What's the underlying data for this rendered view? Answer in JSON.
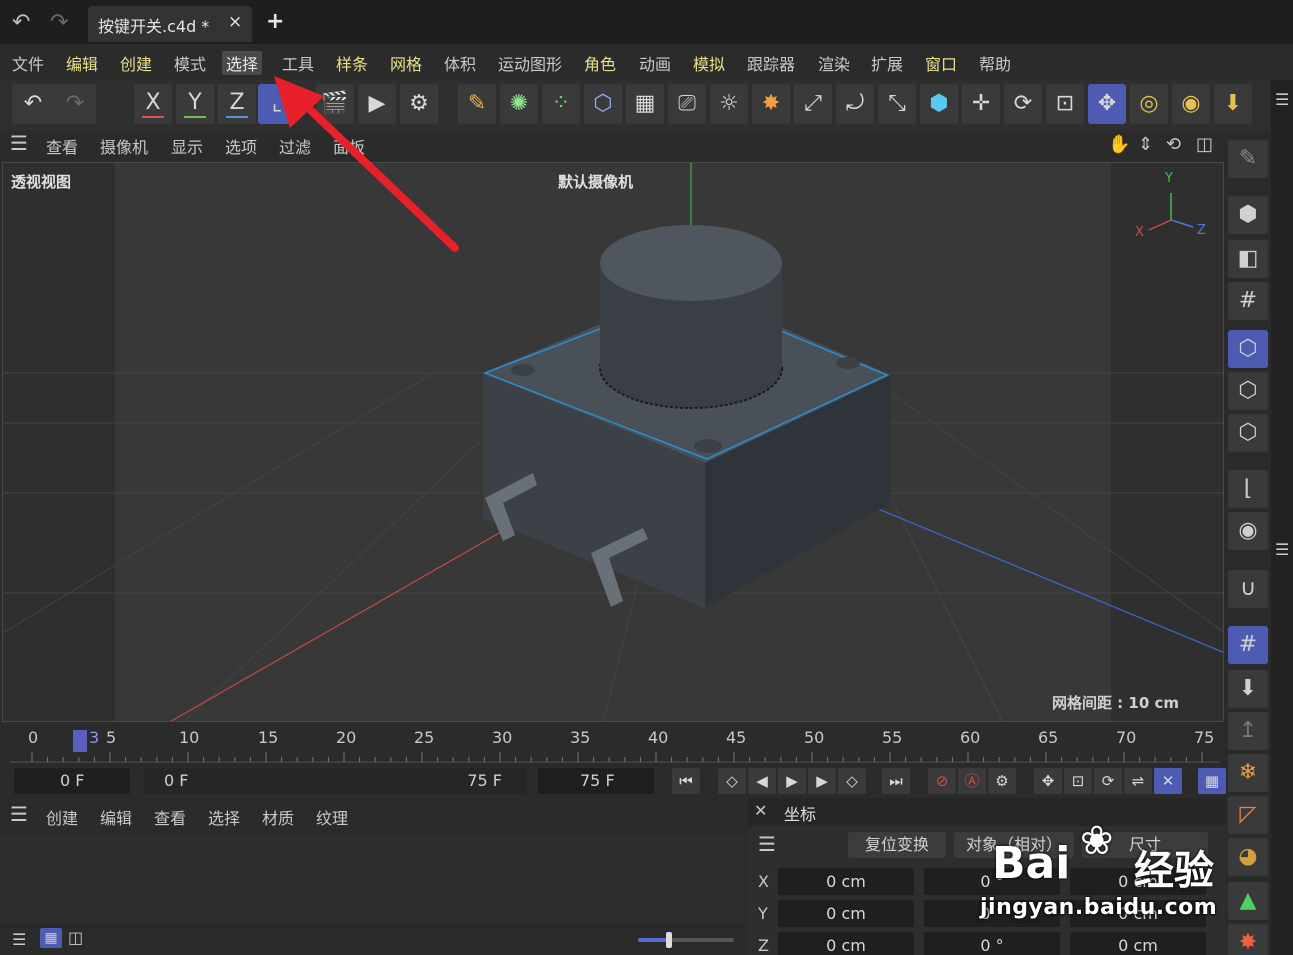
{
  "tabbar": {
    "tab_title": "按键开关.c4d *",
    "close_glyph": "×",
    "add_glyph": "+"
  },
  "menubar": {
    "items": [
      "文件",
      "编辑",
      "创建",
      "模式",
      "选择",
      "工具",
      "样条",
      "网格",
      "体积",
      "运动图形",
      "角色",
      "动画",
      "模拟",
      "跟踪器",
      "渲染",
      "扩展",
      "窗口",
      "帮助"
    ],
    "active": "选择"
  },
  "toolbar": {
    "axes": [
      "X",
      "Y",
      "Z"
    ],
    "axis_colors": [
      "#e05050",
      "#70c050",
      "#5a8ee8"
    ]
  },
  "viewport_menu": {
    "items": [
      "查看",
      "摄像机",
      "显示",
      "选项",
      "过滤",
      "面板"
    ]
  },
  "viewport": {
    "label": "透视视图",
    "camera": "默认摄像机",
    "grid_spacing": "网格间距 : 10 cm",
    "gizmo_x": "X",
    "gizmo_y": "Y",
    "gizmo_z": "Z"
  },
  "timeline": {
    "ticks": [
      "0",
      "5",
      "10",
      "15",
      "20",
      "25",
      "30",
      "35",
      "40",
      "45",
      "50",
      "55",
      "60",
      "65",
      "70",
      "75"
    ],
    "current_frame": "3",
    "field_current": "0 F",
    "field_start": "0 F",
    "field_end_inner": "75 F",
    "field_end": "75 F"
  },
  "material_panel": {
    "menu": [
      "创建",
      "编辑",
      "查看",
      "选择",
      "材质",
      "纹理"
    ]
  },
  "coord_panel": {
    "title": "坐标",
    "reset_button": "复位变换",
    "mode_select": "对象（相对）",
    "size_select": "尺寸",
    "rows": [
      {
        "axis": "X",
        "pos": "0 cm",
        "rot": "0 °",
        "size": "0 cm"
      },
      {
        "axis": "Y",
        "pos": "0 cm",
        "rot": "0 °",
        "size": "0 cm"
      },
      {
        "axis": "Z",
        "pos": "0 cm",
        "rot": "0 °",
        "size": "0 cm"
      }
    ]
  },
  "watermark": {
    "brand": "Bai",
    "brand2": "经验",
    "url": "jingyan.baidu.com"
  },
  "annotation": {
    "arrow_color": "#e8202a"
  }
}
